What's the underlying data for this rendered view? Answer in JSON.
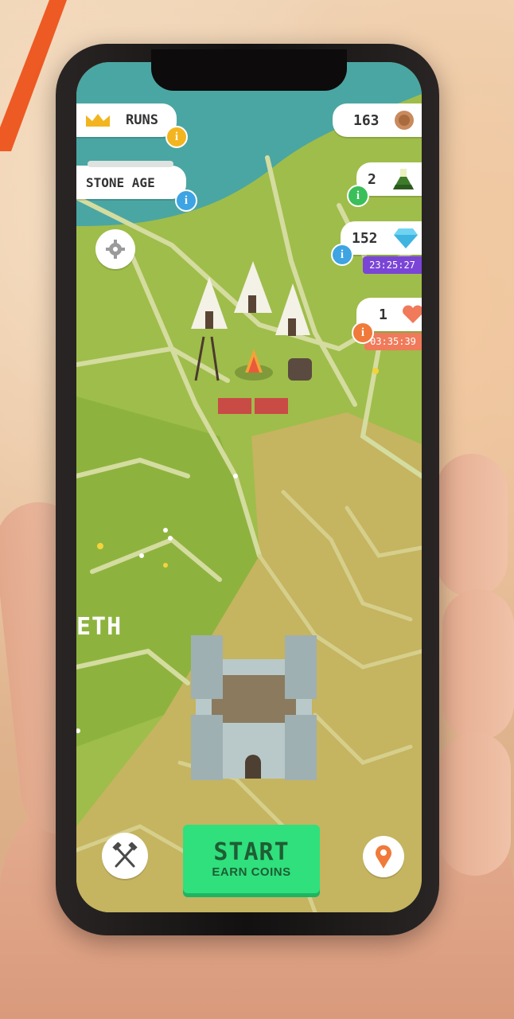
{
  "hud": {
    "runs_label": "RUNS",
    "age_label": "STONE AGE",
    "coins": "163",
    "potions": "2",
    "gems": "152",
    "gems_timer": "23:25:27",
    "lives": "1",
    "lives_timer": "03:35:39",
    "info_glyph": "i"
  },
  "map": {
    "district_label": "ETH"
  },
  "bottom": {
    "start_label": "START",
    "earn_label": "EARN COINS"
  },
  "colors": {
    "start_button": "#2fe07d",
    "gems_timer": "#7a45d6",
    "lives_timer": "#f07a5a",
    "info_yellow": "#f2b51f",
    "info_green": "#3bbf5a",
    "info_blue": "#3ea4e3",
    "info_orange": "#f07a3a",
    "map_grass": "#9fbd4a",
    "map_field": "#c5b460"
  },
  "icons": {
    "runs": "crown-icon",
    "coins": "coin-icon",
    "potions": "flask-icon",
    "gems": "diamond-icon",
    "lives": "heart-icon",
    "settings": "gear-icon",
    "tools": "crossed-hammers-icon",
    "location": "map-pin-icon"
  }
}
